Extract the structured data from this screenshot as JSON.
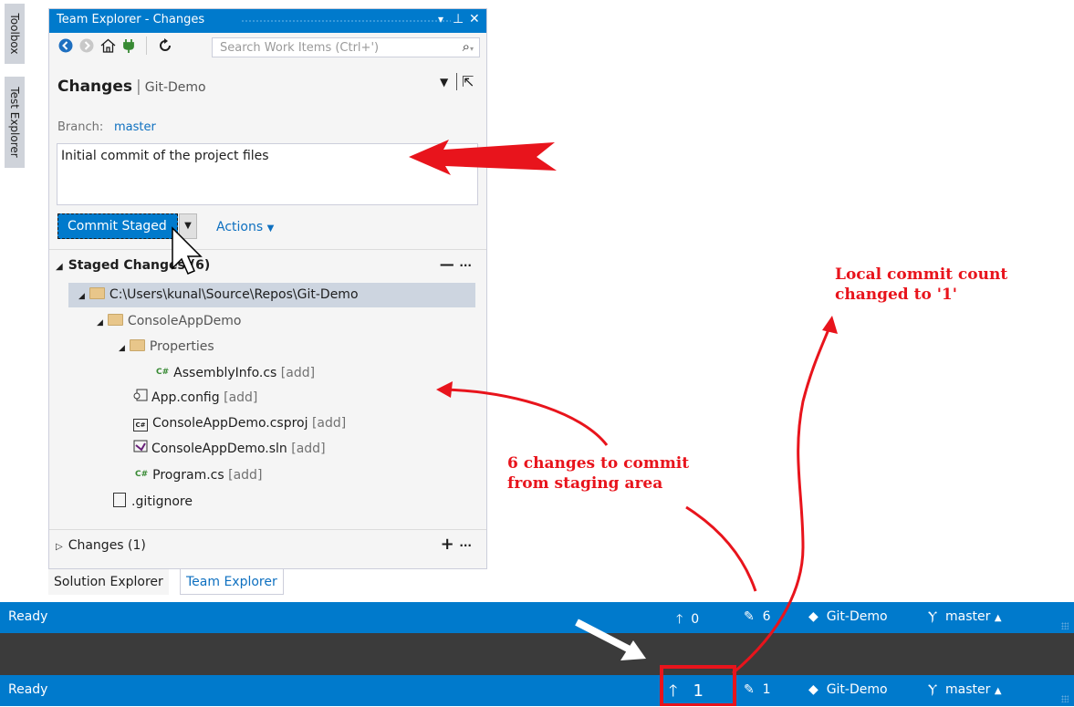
{
  "left_tabs": [
    "Toolbox",
    "Test Explorer"
  ],
  "window": {
    "title": "Team Explorer - Changes",
    "controls": [
      "▾",
      "⊥",
      "✕"
    ]
  },
  "toolbar": {
    "search_placeholder": "Search Work Items (Ctrl+')"
  },
  "header": {
    "title": "Changes",
    "repo": "Git-Demo"
  },
  "branch": {
    "label": "Branch:",
    "value": "master"
  },
  "commit_message": "Initial commit of the project files",
  "commit_button": "Commit Staged",
  "actions_label": "Actions",
  "staged": {
    "header": "Staged Changes (6)",
    "items": [
      {
        "name": "C:\\Users\\kunal\\Source\\Repos\\Git-Demo",
        "tag": ""
      },
      {
        "name": "ConsoleAppDemo",
        "tag": ""
      },
      {
        "name": "Properties",
        "tag": ""
      },
      {
        "name": "AssemblyInfo.cs",
        "tag": "[add]"
      },
      {
        "name": "App.config",
        "tag": "[add]"
      },
      {
        "name": "ConsoleAppDemo.csproj",
        "tag": "[add]"
      },
      {
        "name": "ConsoleAppDemo.sln",
        "tag": "[add]"
      },
      {
        "name": "Program.cs",
        "tag": "[add]"
      },
      {
        "name": ".gitignore",
        "tag": ""
      }
    ]
  },
  "changes": {
    "header": "Changes (1)"
  },
  "bottom_tabs": [
    "Solution Explorer",
    "Team Explorer"
  ],
  "status_before": {
    "ready": "Ready",
    "outgoing": "0",
    "pending": "6",
    "repo": "Git-Demo",
    "branch": "master"
  },
  "status_after": {
    "ready": "Ready",
    "outgoing": "1",
    "pending": "1",
    "repo": "Git-Demo",
    "branch": "master"
  },
  "annotations": {
    "local_commit": [
      "Local commit count",
      "changed to '1'"
    ],
    "six_changes": [
      "6 changes to commit",
      "from staging area"
    ]
  },
  "colors": {
    "accent": "#007acc",
    "annotation": "#e8141c",
    "link": "#0e70c0"
  }
}
